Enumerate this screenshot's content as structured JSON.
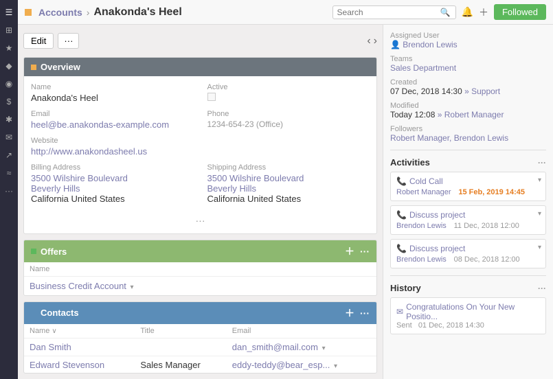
{
  "sidebar": {
    "icons": [
      "≡",
      "⊞",
      "★",
      "♦",
      "◉",
      "$",
      "✱",
      "✉",
      "↗",
      "≈",
      "···"
    ]
  },
  "topbar": {
    "accounts_label": "Accounts",
    "separator": "›",
    "title": "Anakonda's Heel",
    "search_placeholder": "Search",
    "followed_label": "Followed"
  },
  "toolbar": {
    "edit_label": "Edit",
    "more_label": "···"
  },
  "overview": {
    "title": "Overview",
    "fields": {
      "name_label": "Name",
      "name_value": "Anakonda's Heel",
      "active_label": "Active",
      "email_label": "Email",
      "email_value": "heel@be.anakondas-example.com",
      "phone_label": "Phone",
      "phone_value": "1234-654-23 (Office)",
      "website_label": "Website",
      "website_value": "http://www.anakondasheel.us",
      "billing_label": "Billing Address",
      "billing_line1": "3500 Wilshire Boulevard",
      "billing_city": "Beverly Hills",
      "billing_state": "California United States",
      "shipping_label": "Shipping Address",
      "shipping_line1": "3500 Wilshire Boulevard",
      "shipping_city": "Beverly Hills",
      "shipping_state": "California United States"
    }
  },
  "offers": {
    "title": "Offers",
    "col_name": "Name",
    "row": {
      "name": "Business Credit Account"
    }
  },
  "contacts": {
    "title": "Contacts",
    "col_name": "Name",
    "col_title": "Title",
    "col_email": "Email",
    "rows": [
      {
        "name": "Dan Smith",
        "title": "",
        "email": "dan_smith@mail.com"
      },
      {
        "name": "Edward Stevenson",
        "title": "Sales Manager",
        "email": "eddy-teddy@bear_esp..."
      }
    ]
  },
  "right_panel": {
    "assigned_label": "Assigned User",
    "assigned_user": "Brendon Lewis",
    "teams_label": "Teams",
    "teams_value": "Sales Department",
    "created_label": "Created",
    "created_value": "07 Dec, 2018 14:30",
    "created_suffix": "» Support",
    "modified_label": "Modified",
    "modified_value": "Today 12:08",
    "modified_suffix": "» Robert Manager",
    "followers_label": "Followers",
    "followers_value": "Robert Manager, Brendon Lewis",
    "activities_label": "Activities",
    "activities": [
      {
        "type": "Cold Call",
        "user": "Robert Manager",
        "date": "15 Feb, 2019 14:45"
      },
      {
        "type": "Discuss project",
        "user": "Brendon Lewis",
        "date": "11 Dec, 2018 12:00"
      },
      {
        "type": "Discuss project",
        "user": "Brendon Lewis",
        "date": "08 Dec, 2018 12:00"
      }
    ],
    "history_label": "History",
    "history": [
      {
        "subject": "Congratulations On Your New Positio...",
        "status": "Sent",
        "date": "01 Dec, 2018 14:30"
      }
    ]
  }
}
